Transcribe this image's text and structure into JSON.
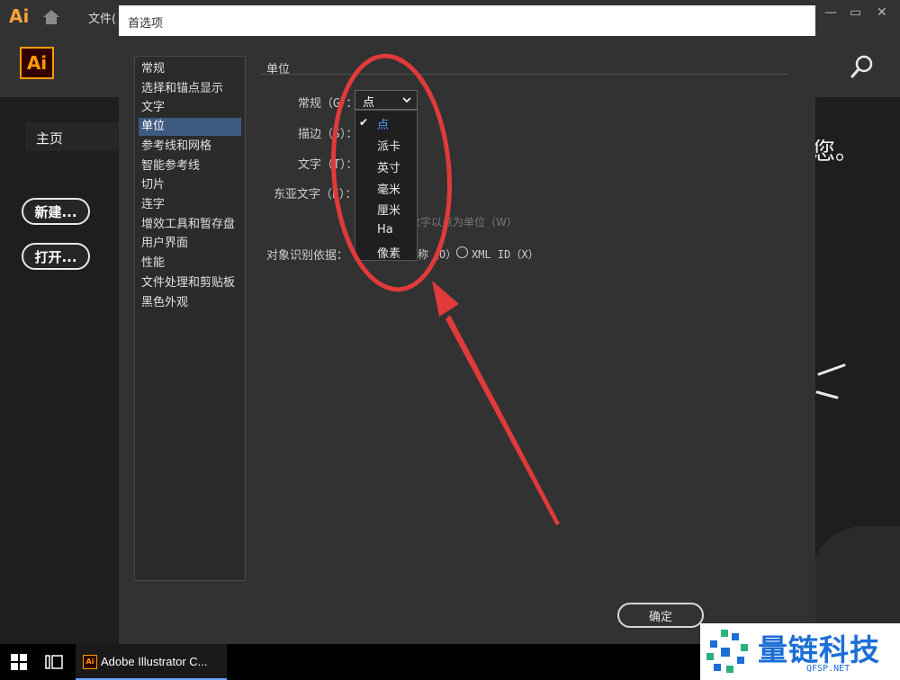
{
  "app": {
    "logo_mini": "Ai",
    "logo": "Ai",
    "menu_file": "文件(",
    "home_tab": "主页",
    "new_button": "新建...",
    "open_button": "打开...",
    "welcome_fragment": "您。",
    "window_controls": [
      "—",
      "▭",
      "✕"
    ]
  },
  "dialog": {
    "title": "首选项",
    "nav_items": [
      {
        "label": "常规"
      },
      {
        "label": "选择和锚点显示"
      },
      {
        "label": "文字"
      },
      {
        "label": "单位",
        "selected": true
      },
      {
        "label": "参考线和网格"
      },
      {
        "label": "智能参考线"
      },
      {
        "label": "切片"
      },
      {
        "label": "连字"
      },
      {
        "label": "增效工具和暂存盘"
      },
      {
        "label": "用户界面"
      },
      {
        "label": "性能"
      },
      {
        "label": "文件处理和剪贴板"
      },
      {
        "label": "黑色外观"
      }
    ],
    "section_title": "单位",
    "fields": {
      "general_label": "常规（G）：",
      "general_value": "点",
      "stroke_label": "描边（S）：",
      "type_label": "文字（T）：",
      "asian_type_label": "东亚文字（E）："
    },
    "numbers_hint": "数字以点为单位（W）",
    "object_id_label": "对象识别依据：",
    "radio_name_partial": "称（O）",
    "radio_xml": "XML ID（X）",
    "dropdown_options": [
      {
        "label": "点",
        "selected": true
      },
      {
        "label": "派卡"
      },
      {
        "label": "英寸"
      },
      {
        "label": "毫米"
      },
      {
        "label": "厘米"
      },
      {
        "label": "Ha"
      },
      {
        "label": "像素"
      }
    ],
    "ok_button": "确定"
  },
  "taskbar": {
    "app_label": "Adobe Illustrator C..."
  },
  "watermark": {
    "name": "量链科技",
    "url": "QFSP.NET"
  },
  "colors": {
    "accent_orange": "#ff9a00",
    "selection_blue": "#3d5a80",
    "annotation_red": "#e03a3a",
    "watermark_blue": "#1c6ed6"
  }
}
